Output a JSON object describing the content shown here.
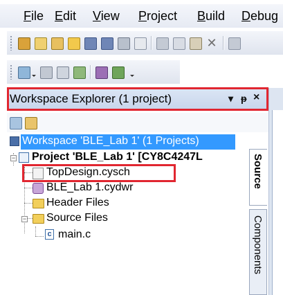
{
  "menubar": {
    "items": [
      {
        "key": "F",
        "rest": "ile"
      },
      {
        "key": "E",
        "rest": "dit"
      },
      {
        "key": "V",
        "rest": "iew"
      },
      {
        "key": "P",
        "rest": "roject"
      },
      {
        "key": "B",
        "rest": "uild"
      },
      {
        "key": "D",
        "rest": "ebug"
      }
    ]
  },
  "workspace_explorer": {
    "title": "Workspace Explorer (1 project)",
    "controls": {
      "dropdown": "▾",
      "pin": "ᵽ",
      "close": "×"
    }
  },
  "tree": {
    "workspace": "Workspace 'BLE_Lab 1' (1 Projects)",
    "project": "Project  'BLE_Lab 1' [CY8C4247L",
    "items": [
      {
        "label": "TopDesign.cysch",
        "icon": "schematic-icon"
      },
      {
        "label": "BLE_Lab 1.cydwr",
        "icon": "design-wide-resources-icon"
      },
      {
        "label": "Header Files",
        "icon": "folder-icon"
      },
      {
        "label": "Source Files",
        "icon": "folder-icon"
      },
      {
        "label": "main.c",
        "icon": "c-file-icon"
      }
    ]
  },
  "side_tabs": {
    "source": "Source",
    "components": "Components"
  },
  "colors": {
    "highlight": "#e12630",
    "selection": "#3399ff",
    "panel_header": "#c7d5eb"
  }
}
